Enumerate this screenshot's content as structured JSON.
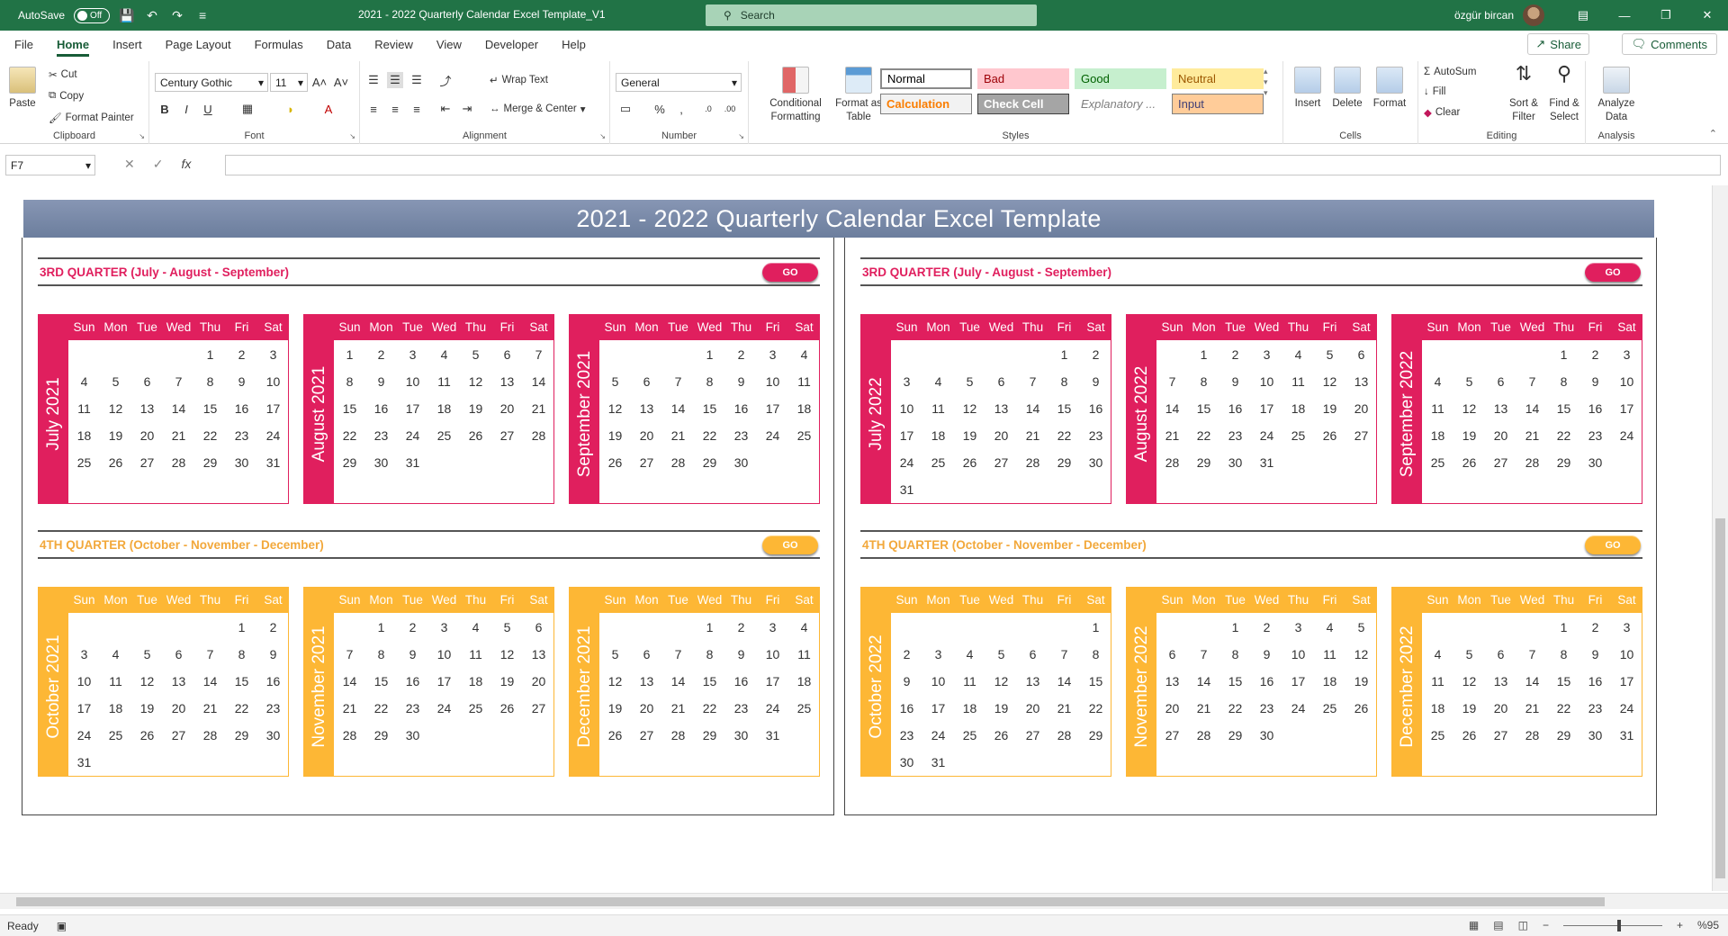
{
  "titlebar": {
    "autosave_label": "AutoSave",
    "autosave_state": "Off",
    "doc_title": "2021 - 2022 Quarterly Calendar Excel Template_V1",
    "search_placeholder": "Search",
    "user_name": "özgür bircan",
    "bg_color": "#217346"
  },
  "menu": {
    "tabs": [
      "File",
      "Home",
      "Insert",
      "Page Layout",
      "Formulas",
      "Data",
      "Review",
      "View",
      "Developer",
      "Help"
    ],
    "active": "Home",
    "share_label": "Share",
    "comments_label": "Comments"
  },
  "ribbon": {
    "clipboard": {
      "label": "Clipboard",
      "paste": "Paste",
      "cut": "Cut",
      "copy": "Copy",
      "format_painter": "Format Painter"
    },
    "font": {
      "label": "Font",
      "family": "Century Gothic",
      "size": "11"
    },
    "alignment": {
      "label": "Alignment",
      "wrap_text": "Wrap Text",
      "merge_center": "Merge & Center"
    },
    "number": {
      "label": "Number",
      "format": "General"
    },
    "styles": {
      "label": "Styles",
      "conditional": "Conditional Formatting",
      "format_table": "Format as Table",
      "cells": [
        {
          "name": "Normal",
          "bg": "#ffffff",
          "fg": "#000000",
          "border": "#9a9a9a"
        },
        {
          "name": "Bad",
          "bg": "#ffc7ce",
          "fg": "#9c0006",
          "border": "#ffc7ce"
        },
        {
          "name": "Good",
          "bg": "#c6efce",
          "fg": "#006100",
          "border": "#c6efce"
        },
        {
          "name": "Neutral",
          "bg": "#ffeb9c",
          "fg": "#9c5700",
          "border": "#ffeb9c"
        },
        {
          "name": "Calculation",
          "bg": "#f2f2f2",
          "fg": "#fa7d00",
          "border": "#7f7f7f"
        },
        {
          "name": "Check Cell",
          "bg": "#a5a5a5",
          "fg": "#ffffff",
          "border": "#3f3f3f"
        },
        {
          "name": "Explanatory ...",
          "bg": "#ffffff",
          "fg": "#7f7f7f",
          "border": "#ffffff"
        },
        {
          "name": "Input",
          "bg": "#ffcc99",
          "fg": "#3f3f76",
          "border": "#7f7f7f"
        }
      ]
    },
    "cells": {
      "label": "Cells",
      "insert": "Insert",
      "delete": "Delete",
      "format": "Format"
    },
    "editing": {
      "label": "Editing",
      "autosum": "AutoSum",
      "fill": "Fill",
      "clear": "Clear",
      "sort": "Sort & Filter",
      "find": "Find & Select"
    },
    "analysis": {
      "label": "Analysis",
      "analyze": "Analyze Data"
    }
  },
  "formula_bar": {
    "name_box": "F7",
    "fx": "fx",
    "content": ""
  },
  "sheet": {
    "banner_title": "2021 - 2022 Quarterly Calendar Excel Template",
    "go_label": "GO",
    "colors": {
      "q3": "#e01f5e",
      "q4": "#fdb735",
      "q4_title": "#f2a83b"
    },
    "weekdays": [
      "Sun",
      "Mon",
      "Tue",
      "Wed",
      "Thu",
      "Fri",
      "Sat"
    ],
    "panels": [
      {
        "year": "2021",
        "quarters": [
          {
            "title": "3RD QUARTER (July - August - September)",
            "theme": "q3",
            "months": [
              {
                "name": "July 2021",
                "start": 4,
                "days": 31
              },
              {
                "name": "August 2021",
                "start": 0,
                "days": 31
              },
              {
                "name": "September 2021",
                "start": 3,
                "days": 30
              }
            ]
          },
          {
            "title": "4TH QUARTER (October - November - December)",
            "theme": "q4",
            "months": [
              {
                "name": "October 2021",
                "start": 5,
                "days": 31
              },
              {
                "name": "November 2021",
                "start": 1,
                "days": 30
              },
              {
                "name": "December 2021",
                "start": 3,
                "days": 31
              }
            ]
          }
        ]
      },
      {
        "year": "2022",
        "quarters": [
          {
            "title": "3RD QUARTER (July - August - September)",
            "theme": "q3",
            "months": [
              {
                "name": "July 2022",
                "start": 5,
                "days": 31
              },
              {
                "name": "August 2022",
                "start": 1,
                "days": 31
              },
              {
                "name": "September 2022",
                "start": 4,
                "days": 30
              }
            ]
          },
          {
            "title": "4TH QUARTER (October - November - December)",
            "theme": "q4",
            "months": [
              {
                "name": "October 2022",
                "start": 6,
                "days": 31
              },
              {
                "name": "November 2022",
                "start": 2,
                "days": 30
              },
              {
                "name": "December 2022",
                "start": 4,
                "days": 31
              }
            ]
          }
        ]
      }
    ]
  },
  "status": {
    "ready": "Ready",
    "zoom": "%95"
  }
}
